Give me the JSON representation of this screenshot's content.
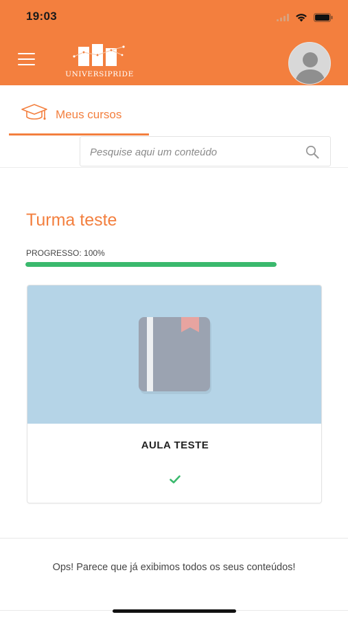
{
  "status_bar": {
    "time": "19:03"
  },
  "header": {
    "logo_text": "UNIVERSIPRIDE",
    "menu_icon": "hamburger-menu-icon",
    "avatar_icon": "user-avatar-icon",
    "color": "#f37f3e"
  },
  "tabs": {
    "courses_label": "Meus cursos",
    "courses_icon": "graduation-cap-icon"
  },
  "search": {
    "placeholder": "Pesquise aqui um conteúdo",
    "value": "",
    "icon": "search-icon"
  },
  "course": {
    "title": "Turma teste",
    "progress_label": "PROGRESSO: 100%",
    "progress_percent": 100,
    "progress_color": "#3ab96d"
  },
  "lesson_card": {
    "title": "AULA TESTE",
    "cover_icon": "book-icon",
    "status_icon": "checkmark-icon",
    "cover_color": "#b5d4e7"
  },
  "footer": {
    "message": "Ops! Parece que já exibimos todos os seus conteúdos!"
  }
}
